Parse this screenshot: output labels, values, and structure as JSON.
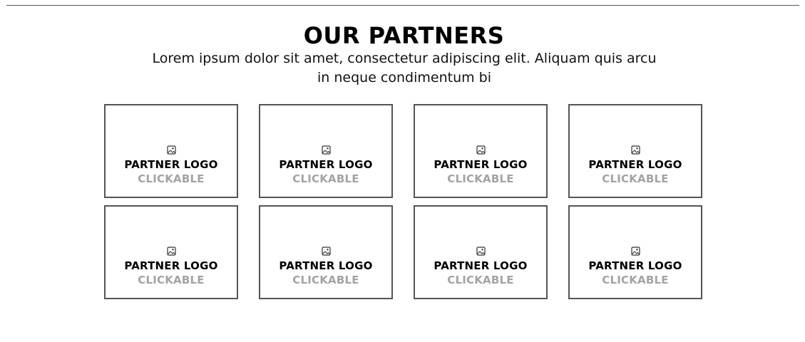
{
  "section": {
    "title": "OUR PARTNERS",
    "subtitle": "Lorem ipsum dolor sit amet, consectetur adipiscing elit. Aliquam quis arcu in neque condimentum bi"
  },
  "partners": [
    {
      "label": "PARTNER LOGO",
      "sublabel": "CLICKABLE",
      "icon": "image-placeholder-icon"
    },
    {
      "label": "PARTNER LOGO",
      "sublabel": "CLICKABLE",
      "icon": "image-placeholder-icon"
    },
    {
      "label": "PARTNER LOGO",
      "sublabel": "CLICKABLE",
      "icon": "image-placeholder-icon"
    },
    {
      "label": "PARTNER LOGO",
      "sublabel": "CLICKABLE",
      "icon": "image-placeholder-icon"
    },
    {
      "label": "PARTNER LOGO",
      "sublabel": "CLICKABLE",
      "icon": "image-placeholder-icon"
    },
    {
      "label": "PARTNER LOGO",
      "sublabel": "CLICKABLE",
      "icon": "image-placeholder-icon"
    },
    {
      "label": "PARTNER LOGO",
      "sublabel": "CLICKABLE",
      "icon": "image-placeholder-icon"
    },
    {
      "label": "PARTNER LOGO",
      "sublabel": "CLICKABLE",
      "icon": "image-placeholder-icon"
    }
  ],
  "colors": {
    "text": "#000000",
    "muted_text": "#a3a3a3",
    "border": "#555555",
    "background": "#ffffff"
  }
}
